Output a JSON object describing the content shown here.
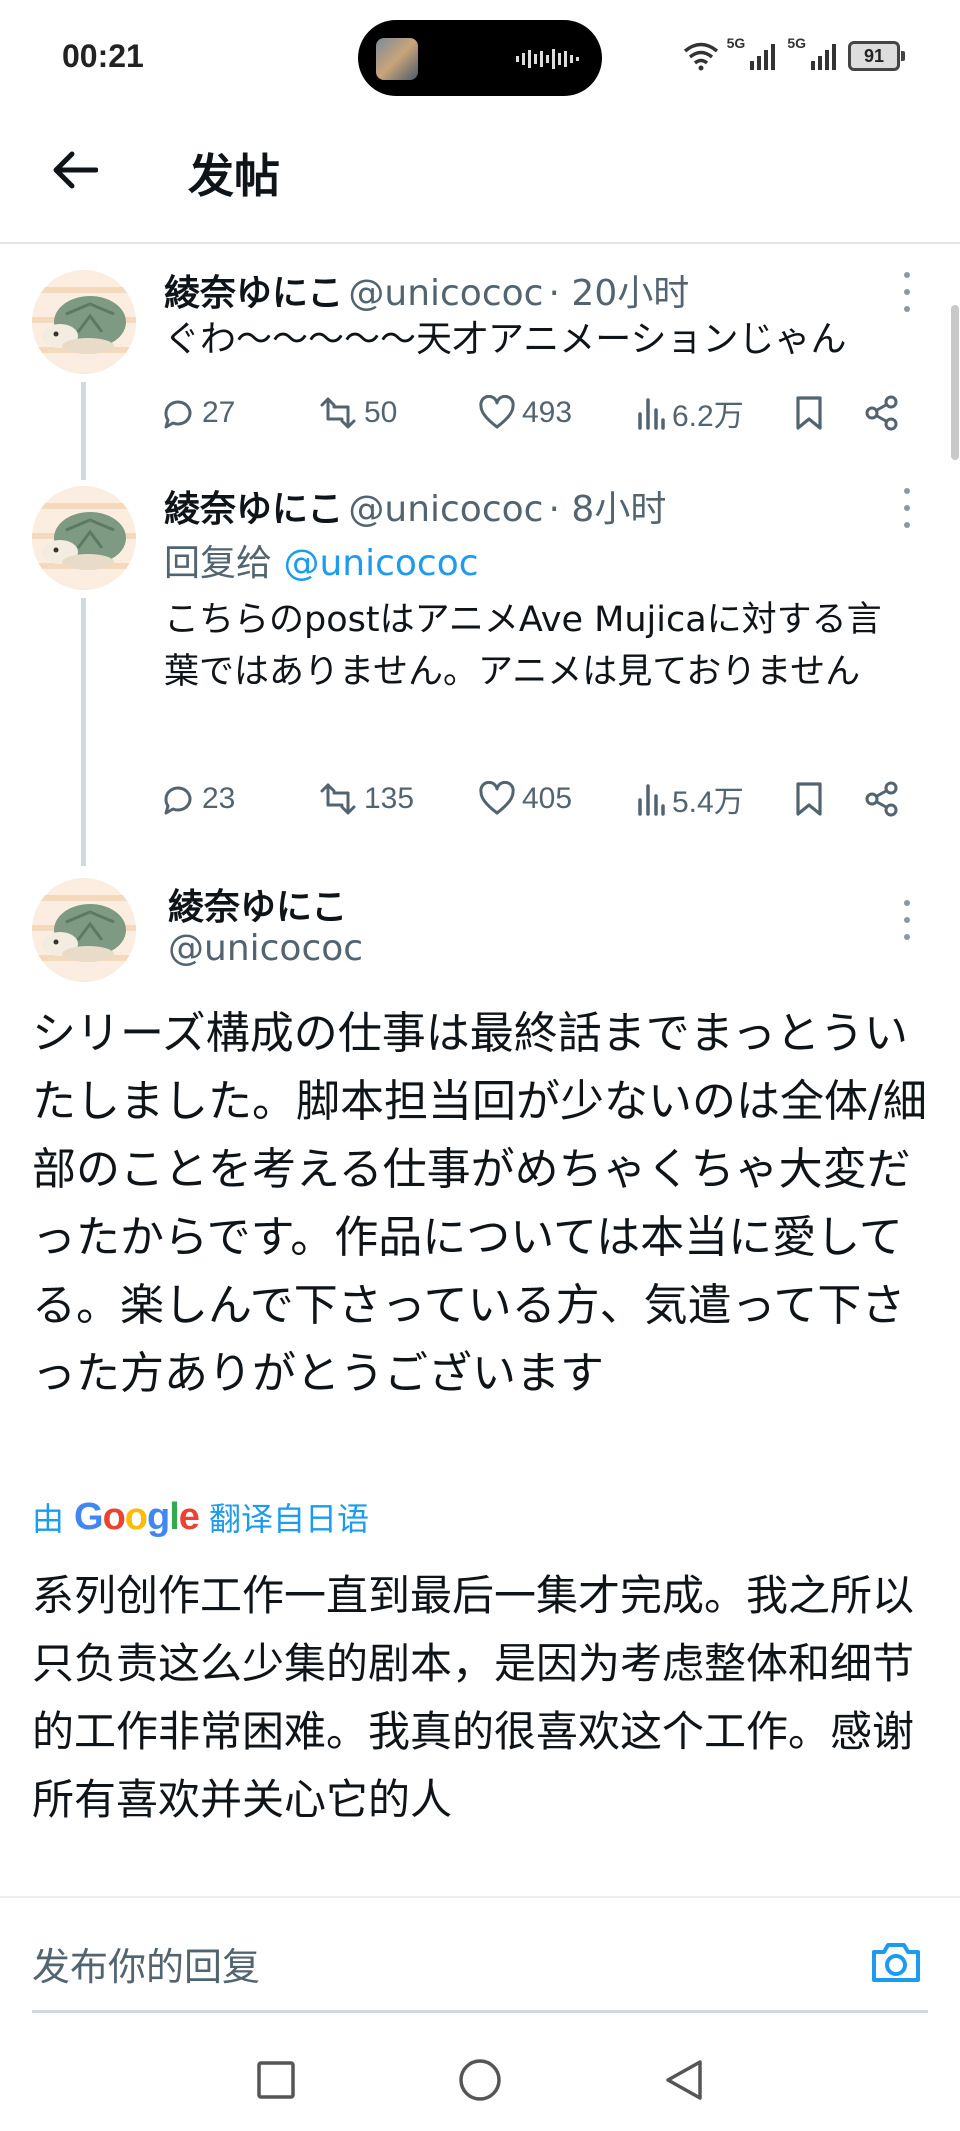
{
  "status_bar": {
    "time": "00:21",
    "network_1": "5G",
    "network_2": "5G",
    "battery": "91"
  },
  "header": {
    "title": "发帖"
  },
  "tweets": [
    {
      "name": "綾奈ゆにこ",
      "handle": "@unicococ",
      "time": "· 20小时",
      "text": "ぐわ〜〜〜〜〜天才アニメーションじゃん",
      "replies": "27",
      "retweets": "50",
      "likes": "493",
      "views": "6.2万"
    },
    {
      "name": "綾奈ゆにこ",
      "handle": "@unicococ",
      "time": "· 8小时",
      "reply_prefix": "回复给",
      "reply_to": "@unicococ",
      "text": "こちらのpostはアニメAve Mujicaに対する言葉ではありません。アニメは見ておりません",
      "replies": "23",
      "retweets": "135",
      "likes": "405",
      "views": "5.4万"
    }
  ],
  "main_tweet": {
    "name": "綾奈ゆにこ",
    "handle": "@unicococ",
    "text": "シリーズ構成の仕事は最終話までまっとういたしました。脚本担当回が少ないのは全体/細部のことを考える仕事がめちゃくちゃ大変だったからです。作品については本当に愛してる。楽しんで下さっている方、気遣って下さった方ありがとうございます",
    "translate_prefix": "由",
    "translate_brand": "Google",
    "translate_suffix": "翻译自日语",
    "translated_text": "系列创作工作一直到最后一集才完成。我之所以只负责这么少集的剧本，是因为考虑整体和细节的工作非常困难。我真的很喜欢这个工作。感谢所有喜欢并关心它的人"
  },
  "reply_box": {
    "placeholder": "发布你的回复"
  },
  "colors": {
    "accent": "#1d9bf0",
    "secondary_text": "#536471"
  },
  "icons": [
    "back-arrow-icon",
    "more-icon",
    "reply-icon",
    "retweet-icon",
    "like-icon",
    "views-icon",
    "bookmark-icon",
    "share-icon",
    "camera-icon",
    "recent-apps-icon",
    "home-icon",
    "back-icon"
  ]
}
